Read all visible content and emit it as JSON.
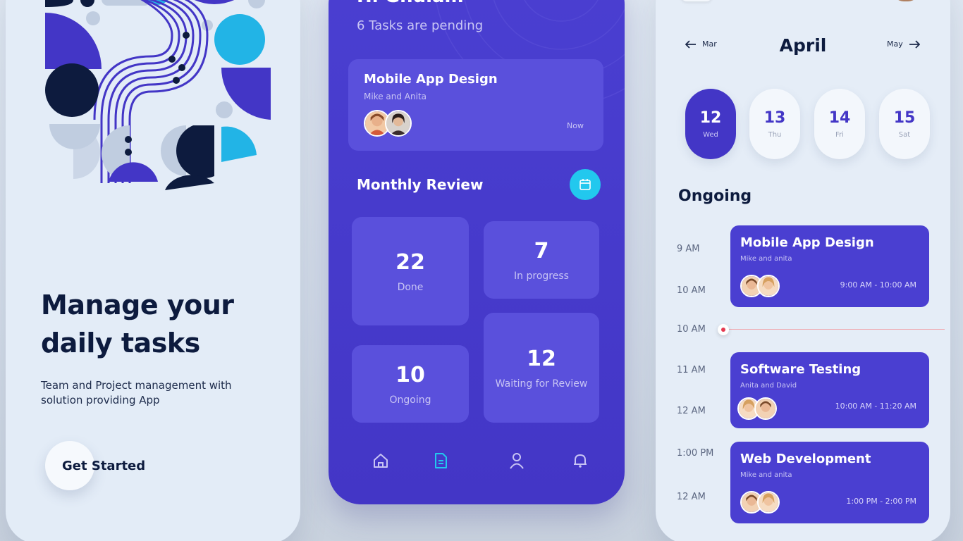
{
  "onboarding": {
    "title": "Manage your\ndaily tasks",
    "subtitle": "Team and Project management with\nsolution providing App",
    "cta": "Get Started"
  },
  "dashboard": {
    "greeting": "Hi Ghulam",
    "pending": "6 Tasks are pending",
    "featured": {
      "title": "Mobile App Design",
      "members": "Mike and Anita",
      "time": "Now"
    },
    "section_title": "Monthly Review",
    "stats": [
      {
        "value": "22",
        "label": "Done"
      },
      {
        "value": "7",
        "label": "In progress"
      },
      {
        "value": "10",
        "label": "Ongoing"
      },
      {
        "value": "12",
        "label": "Waiting for Review"
      }
    ],
    "nav": [
      "home-icon",
      "document-icon",
      "profile-icon",
      "bell-icon"
    ],
    "accent": "#22c8ee",
    "brand": "#4a3fd1"
  },
  "schedule": {
    "month_prev": "Mar",
    "month": "April",
    "month_next": "May",
    "days": [
      {
        "num": "12",
        "dow": "Wed"
      },
      {
        "num": "13",
        "dow": "Thu"
      },
      {
        "num": "14",
        "dow": "Fri"
      },
      {
        "num": "15",
        "dow": "Sat"
      }
    ],
    "section_title": "Ongoing",
    "times": [
      "9 AM",
      "10 AM",
      "10 AM",
      "11 AM",
      "12 AM",
      "1:00 PM",
      "12 AM"
    ],
    "events": [
      {
        "title": "Mobile App Design",
        "members": "Mike and anita",
        "time": "9:00 AM - 10:00 AM"
      },
      {
        "title": "Software Testing",
        "members": "Anita and David",
        "time": "10:00 AM - 11:20 AM"
      },
      {
        "title": "Web Development",
        "members": "Mike and anita",
        "time": "1:00 PM - 2:00 PM"
      }
    ],
    "now_color": "#e53950"
  }
}
